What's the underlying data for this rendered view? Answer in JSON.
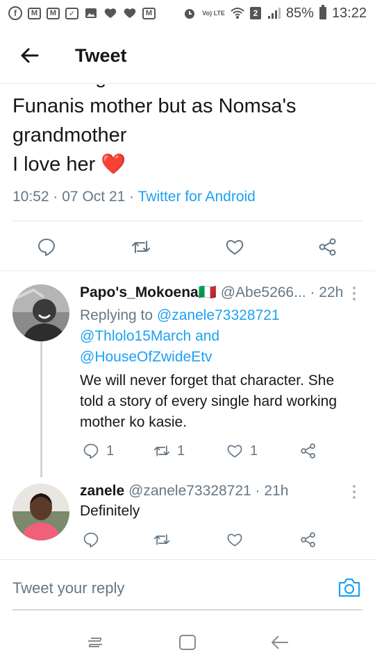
{
  "status_bar": {
    "battery": "85%",
    "time": "13:22",
    "network_lte": "Vo) LTE",
    "sim_slot": "2",
    "left_icons": [
      "facebook-icon",
      "gmail-icon",
      "gmail-icon",
      "checkbox-icon",
      "gallery-icon",
      "heart-icon",
      "heart-icon",
      "gmail-icon"
    ]
  },
  "header": {
    "title": "Tweet"
  },
  "tweet": {
    "text": "that I imagined her on not as\nFunanis mother but as Nomsa's\ngrandmother\nI love her ❤️",
    "time": "10:52",
    "date": "07 Oct 21",
    "separator": "·",
    "source": "Twitter for Android"
  },
  "replies": [
    {
      "name": "Papo's_Mokoena🇮🇹",
      "handle": "@Abe5266...",
      "time": "· 22h",
      "replying_prefix": "Replying to",
      "mention_1": "@zanele73328721",
      "mention_2": "@Thlolo15March",
      "and_word": "and",
      "mention_3": "@HouseOfZwideEtv",
      "text": "We will never forget that character. She told a story of every single hard working mother ko kasie.",
      "reply_count": "1",
      "retweet_count": "1",
      "like_count": "1"
    },
    {
      "name": "zanele",
      "handle": "@zanele73328721",
      "time": "· 21h",
      "text": "Definitely"
    }
  ],
  "compose": {
    "placeholder": "Tweet your reply"
  },
  "colors": {
    "accent": "#1da1f2",
    "secondary_text": "#657786",
    "divider": "#e1e8ed",
    "heart": "#e0245e"
  }
}
